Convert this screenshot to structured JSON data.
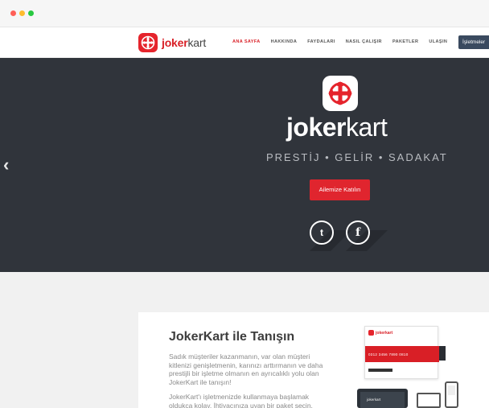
{
  "window": {
    "controls": [
      "close",
      "minimize",
      "maximize"
    ]
  },
  "header": {
    "logo": {
      "bold": "joker",
      "light": "kart"
    },
    "nav": [
      {
        "label": "ANA SAYFA",
        "active": true
      },
      {
        "label": "HAKKINDA",
        "active": false
      },
      {
        "label": "FAYDALARI",
        "active": false
      },
      {
        "label": "NASIL ÇALIŞIR",
        "active": false
      },
      {
        "label": "PAKETLER",
        "active": false
      },
      {
        "label": "ULAŞIN",
        "active": false
      }
    ],
    "cta_button": "İşletmeler"
  },
  "hero": {
    "prev_icon": "chevron-left-icon",
    "brand_bold": "joker",
    "brand_light": "kart",
    "tagline": "PRESTİJ • GELİR • SADAKAT",
    "cta": "Ailemize Katılın",
    "social": [
      {
        "name": "twitter-icon",
        "glyph": "t"
      },
      {
        "name": "facebook-icon",
        "glyph": "f"
      }
    ]
  },
  "intro": {
    "title": "JokerKart ile Tanışın",
    "paragraph1": "Sadık müşteriler kazanmanın, var olan müşteri kitlenizi genişletmenin, karınızı arttırmanın ve daha prestijli bir işletme olmanın en ayrıcalıklı yolu olan JokerKart ile tanışın!",
    "paragraph2": "JokerKart'ı işletmenizde kullanmaya başlamak oldukça kolay. İhtiyacınıza uyan bir paket seçin."
  },
  "mockup": {
    "card_brand": "jokerkart",
    "card_number": "0312 3456 7890 0810",
    "device_label": "jokerkart"
  },
  "colors": {
    "brand_red": "#e0252e",
    "hero_bg": "#30343b",
    "nav_button": "#3a4a5f"
  }
}
